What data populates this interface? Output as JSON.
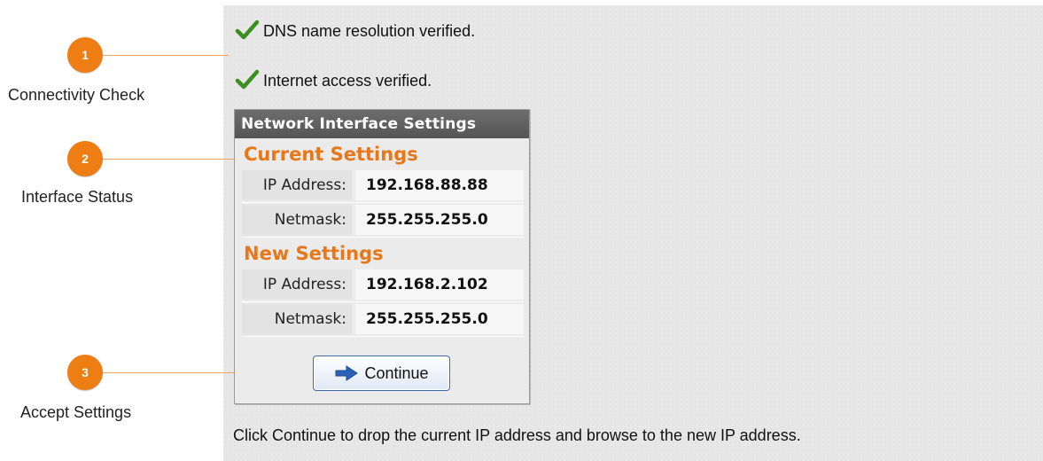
{
  "callouts": [
    {
      "number": "1",
      "label": "Connectivity Check"
    },
    {
      "number": "2",
      "label": "Interface Status"
    },
    {
      "number": "3",
      "label": "Accept Settings"
    }
  ],
  "status_messages": {
    "dns": "DNS name resolution verified.",
    "internet": "Internet access verified."
  },
  "network_box": {
    "title": "Network Interface Settings",
    "current": {
      "heading": "Current Settings",
      "ip_label": "IP Address:",
      "ip_value": "192.168.88.88",
      "netmask_label": "Netmask:",
      "netmask_value": "255.255.255.0"
    },
    "new": {
      "heading": "New Settings",
      "ip_label": "IP Address:",
      "ip_value": "192.168.2.102",
      "netmask_label": "Netmask:",
      "netmask_value": "255.255.255.0"
    },
    "continue_label": "Continue"
  },
  "footer": "Click Continue to drop the current IP address and browse to the new IP address.",
  "colors": {
    "accent": "#ee7d14",
    "heading": "#e8771a",
    "check": "#3a8f1f",
    "arrow": "#2b62b8"
  },
  "icons": {
    "check": "check-icon",
    "arrow": "arrow-right-icon"
  }
}
